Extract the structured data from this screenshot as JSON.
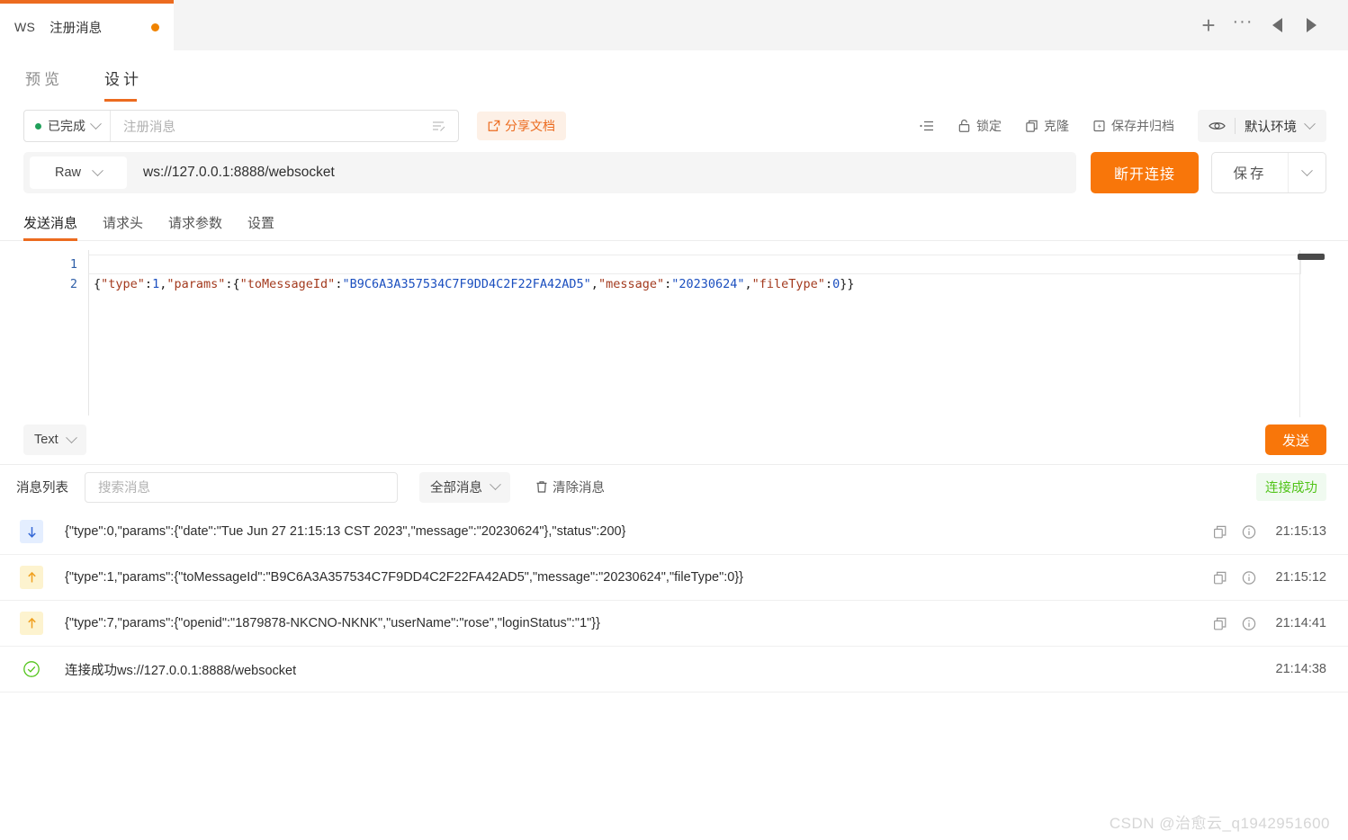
{
  "window": {
    "tab": {
      "protocol": "WS",
      "title": "注册消息",
      "modified_dot": "●"
    },
    "actions": {
      "new": "+",
      "more": "···",
      "prev": "◀",
      "next": "▶"
    }
  },
  "view_tabs": [
    {
      "label": "预览",
      "active": false
    },
    {
      "label": "设计",
      "active": true
    }
  ],
  "toolbar": {
    "status": {
      "label": "已完成",
      "color": "#20a05a"
    },
    "name_placeholder": "注册消息",
    "share_label": "分享文档",
    "items": [
      {
        "icon": "indent-icon",
        "label": ""
      },
      {
        "icon": "lock-icon",
        "label": "锁定"
      },
      {
        "icon": "clone-icon",
        "label": "克隆"
      },
      {
        "icon": "archive-icon",
        "label": "保存并归档"
      }
    ],
    "environment": {
      "icon": "eye-icon",
      "name": "默认环境"
    }
  },
  "url_bar": {
    "mode": "Raw",
    "url": "ws://127.0.0.1:8888/websocket",
    "disconnect_label": "断开连接",
    "save_label": "保存"
  },
  "sub_tabs": [
    {
      "label": "发送消息",
      "active": true
    },
    {
      "label": "请求头",
      "active": false
    },
    {
      "label": "请求参数",
      "active": false
    },
    {
      "label": "设置",
      "active": false
    }
  ],
  "editor": {
    "line_numbers": [
      "1",
      "2"
    ],
    "line1": "",
    "line2_tokens": [
      {
        "t": "{",
        "c": "tok-brace"
      },
      {
        "t": "\"type\"",
        "c": "tok-key"
      },
      {
        "t": ":",
        "c": "tok-punct"
      },
      {
        "t": "1",
        "c": "tok-num"
      },
      {
        "t": ",",
        "c": "tok-punct"
      },
      {
        "t": "\"params\"",
        "c": "tok-key"
      },
      {
        "t": ":{",
        "c": "tok-punct"
      },
      {
        "t": "\"toMessageId\"",
        "c": "tok-key"
      },
      {
        "t": ":",
        "c": "tok-punct"
      },
      {
        "t": "\"B9C6A3A357534C7F9DD4C2F22FA42AD5\"",
        "c": "tok-str"
      },
      {
        "t": ",",
        "c": "tok-punct"
      },
      {
        "t": "\"message\"",
        "c": "tok-key"
      },
      {
        "t": ":",
        "c": "tok-punct"
      },
      {
        "t": "\"20230624\"",
        "c": "tok-str"
      },
      {
        "t": ",",
        "c": "tok-punct"
      },
      {
        "t": "\"fileType\"",
        "c": "tok-key"
      },
      {
        "t": ":",
        "c": "tok-punct"
      },
      {
        "t": "0",
        "c": "tok-num"
      },
      {
        "t": "}}",
        "c": "tok-brace"
      }
    ],
    "raw_line2": "{\"type\":1,\"params\":{\"toMessageId\":\"B9C6A3A357534C7F9DD4C2F22FA42AD5\",\"message\":\"20230624\",\"fileType\":0}}"
  },
  "send_row": {
    "format": "Text",
    "send_label": "发送"
  },
  "message_panel": {
    "label": "消息列表",
    "search_placeholder": "搜索消息",
    "filter": "全部消息",
    "clear_label": "清除消息",
    "status_badge": "连接成功",
    "rows": [
      {
        "direction": "down",
        "icon": "arrow-down-icon",
        "text": "{\"type\":0,\"params\":{\"date\":\"Tue Jun 27 21:15:13 CST 2023\",\"message\":\"20230624\"},\"status\":200}",
        "time": "21:15:13",
        "has_actions": true
      },
      {
        "direction": "up",
        "icon": "arrow-up-icon",
        "text": "{\"type\":1,\"params\":{\"toMessageId\":\"B9C6A3A357534C7F9DD4C2F22FA42AD5\",\"message\":\"20230624\",\"fileType\":0}}",
        "time": "21:15:12",
        "has_actions": true
      },
      {
        "direction": "up",
        "icon": "arrow-up-icon",
        "text": "{\"type\":7,\"params\":{\"openid\":\"1879878-NKCNO-NKNK\",\"userName\":\"rose\",\"loginStatus\":\"1\"}}",
        "time": "21:14:41",
        "has_actions": true
      },
      {
        "direction": "ok",
        "icon": "check-circle-icon",
        "text": "连接成功ws://127.0.0.1:8888/websocket",
        "time": "21:14:38",
        "has_actions": false
      }
    ]
  },
  "watermark": "CSDN @治愈云_q1942951600",
  "colors": {
    "accent": "#f8760a",
    "accent_soft": "#fdf0e6",
    "success": "#52c41a",
    "status_green": "#20a05a"
  }
}
